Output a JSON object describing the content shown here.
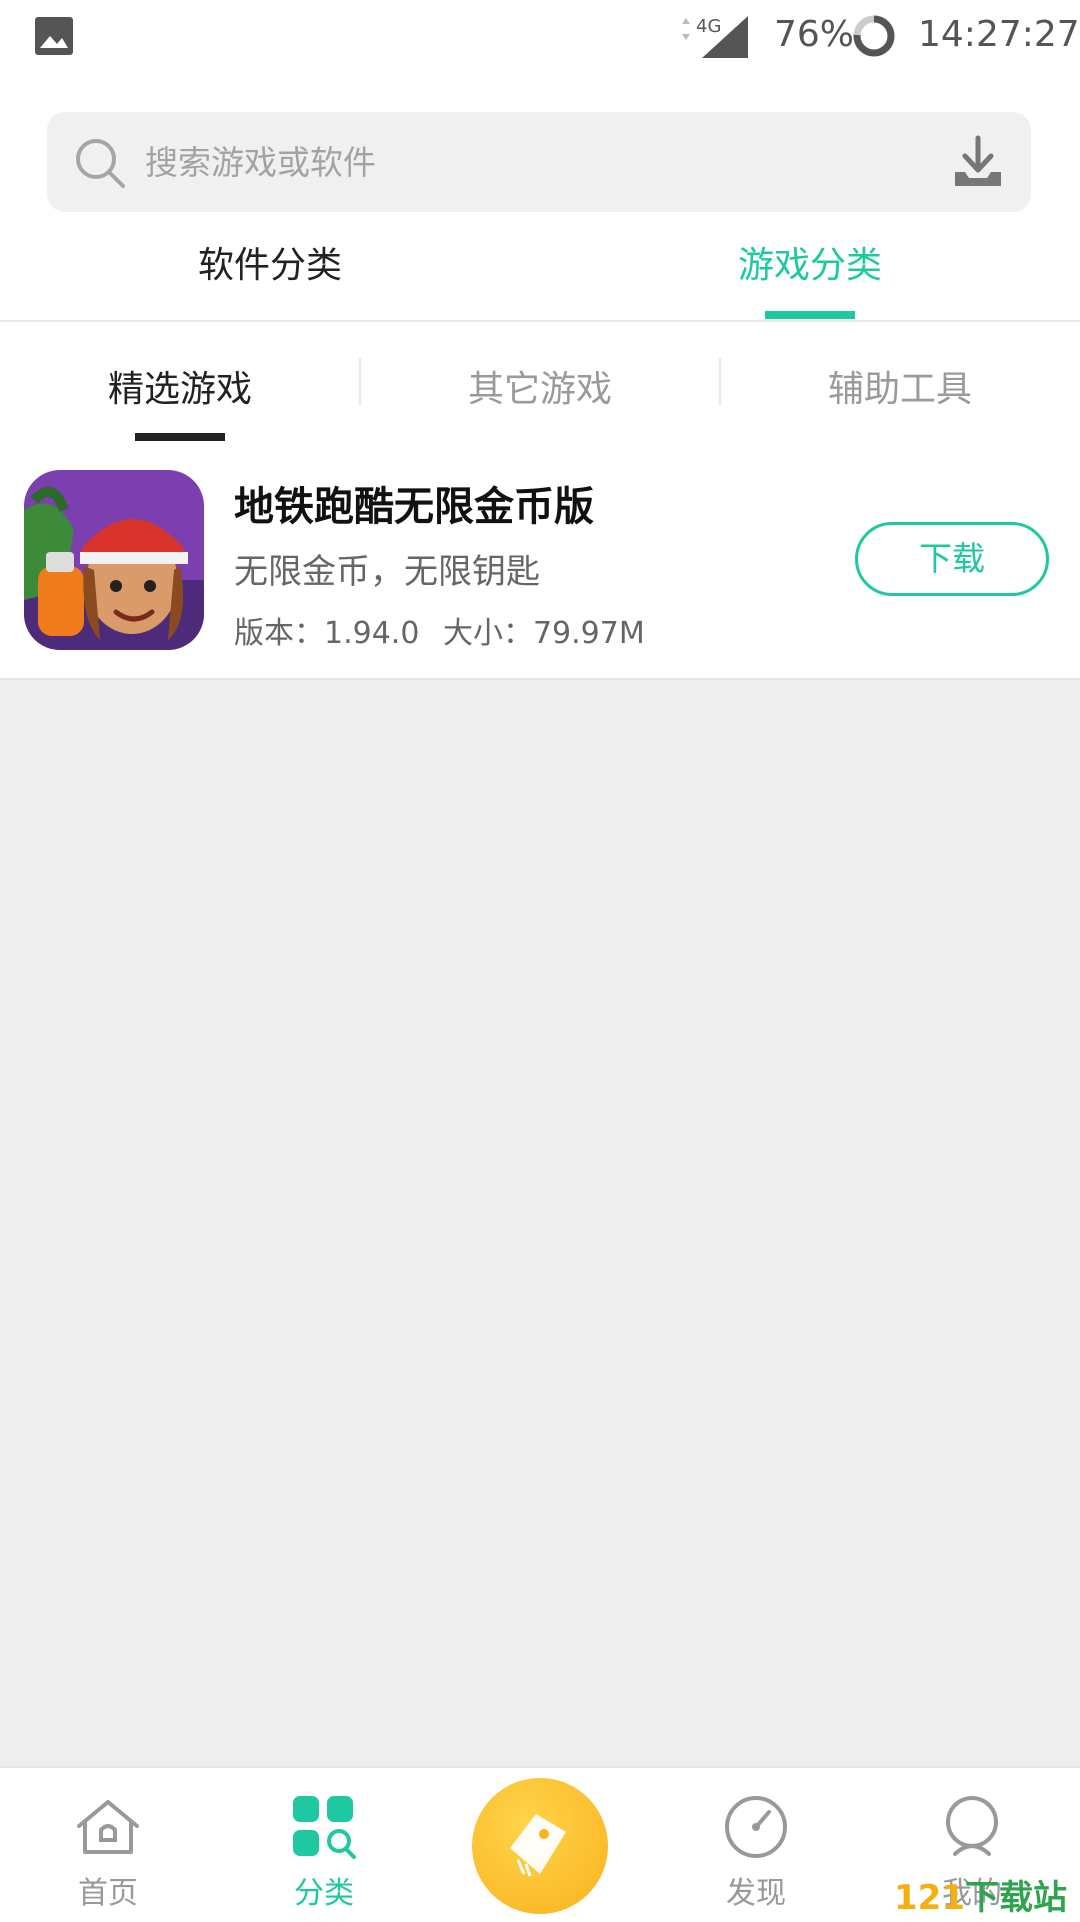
{
  "status_bar": {
    "network": "4G",
    "battery": "76%",
    "time": "14:27:27"
  },
  "search": {
    "placeholder": "搜索游戏或软件"
  },
  "main_tabs": [
    {
      "label": "软件分类",
      "active": false
    },
    {
      "label": "游戏分类",
      "active": true
    }
  ],
  "sub_tabs": [
    {
      "label": "精选游戏",
      "active": true
    },
    {
      "label": "其它游戏",
      "active": false
    },
    {
      "label": "辅助工具",
      "active": false
    }
  ],
  "apps": [
    {
      "name": "地铁跑酷无限金币版",
      "desc": "无限金币，无限钥匙",
      "version": "版本：1.94.0",
      "size": "大小：79.97M",
      "button": "下载",
      "icon": "subway-surfers-icon"
    }
  ],
  "bottom_nav": [
    {
      "label": "首页",
      "icon": "home-icon",
      "active": false
    },
    {
      "label": "分类",
      "icon": "category-icon",
      "active": true
    },
    {
      "label": "",
      "icon": "tag-icon",
      "active": false
    },
    {
      "label": "发现",
      "icon": "compass-icon",
      "active": false
    },
    {
      "label": "我的",
      "icon": "profile-icon",
      "active": false
    }
  ],
  "watermark": {
    "number": "121",
    "text": "下载站"
  },
  "colors": {
    "accent": "#1ec8a0",
    "center_button": "#f9b21e",
    "background": "#eeeeee"
  }
}
